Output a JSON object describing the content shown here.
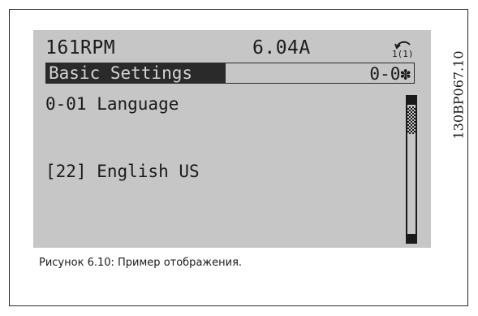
{
  "display": {
    "speed": "161RPM",
    "current": "6.04A",
    "status_icon": "motor-rotation-icon",
    "status_icon_text": "1(1)",
    "menu_title": "Basic Settings",
    "menu_code": "0-0✽",
    "parameter": "0-01 Language",
    "value": "[22] English US"
  },
  "side_label": "130BP067.10",
  "caption": "Рисунок 6.10: Пример отображения.",
  "colors": {
    "lcd_background": "#c6c6c6",
    "lcd_ink": "#1a1a1a",
    "page_background": "#ffffff"
  }
}
